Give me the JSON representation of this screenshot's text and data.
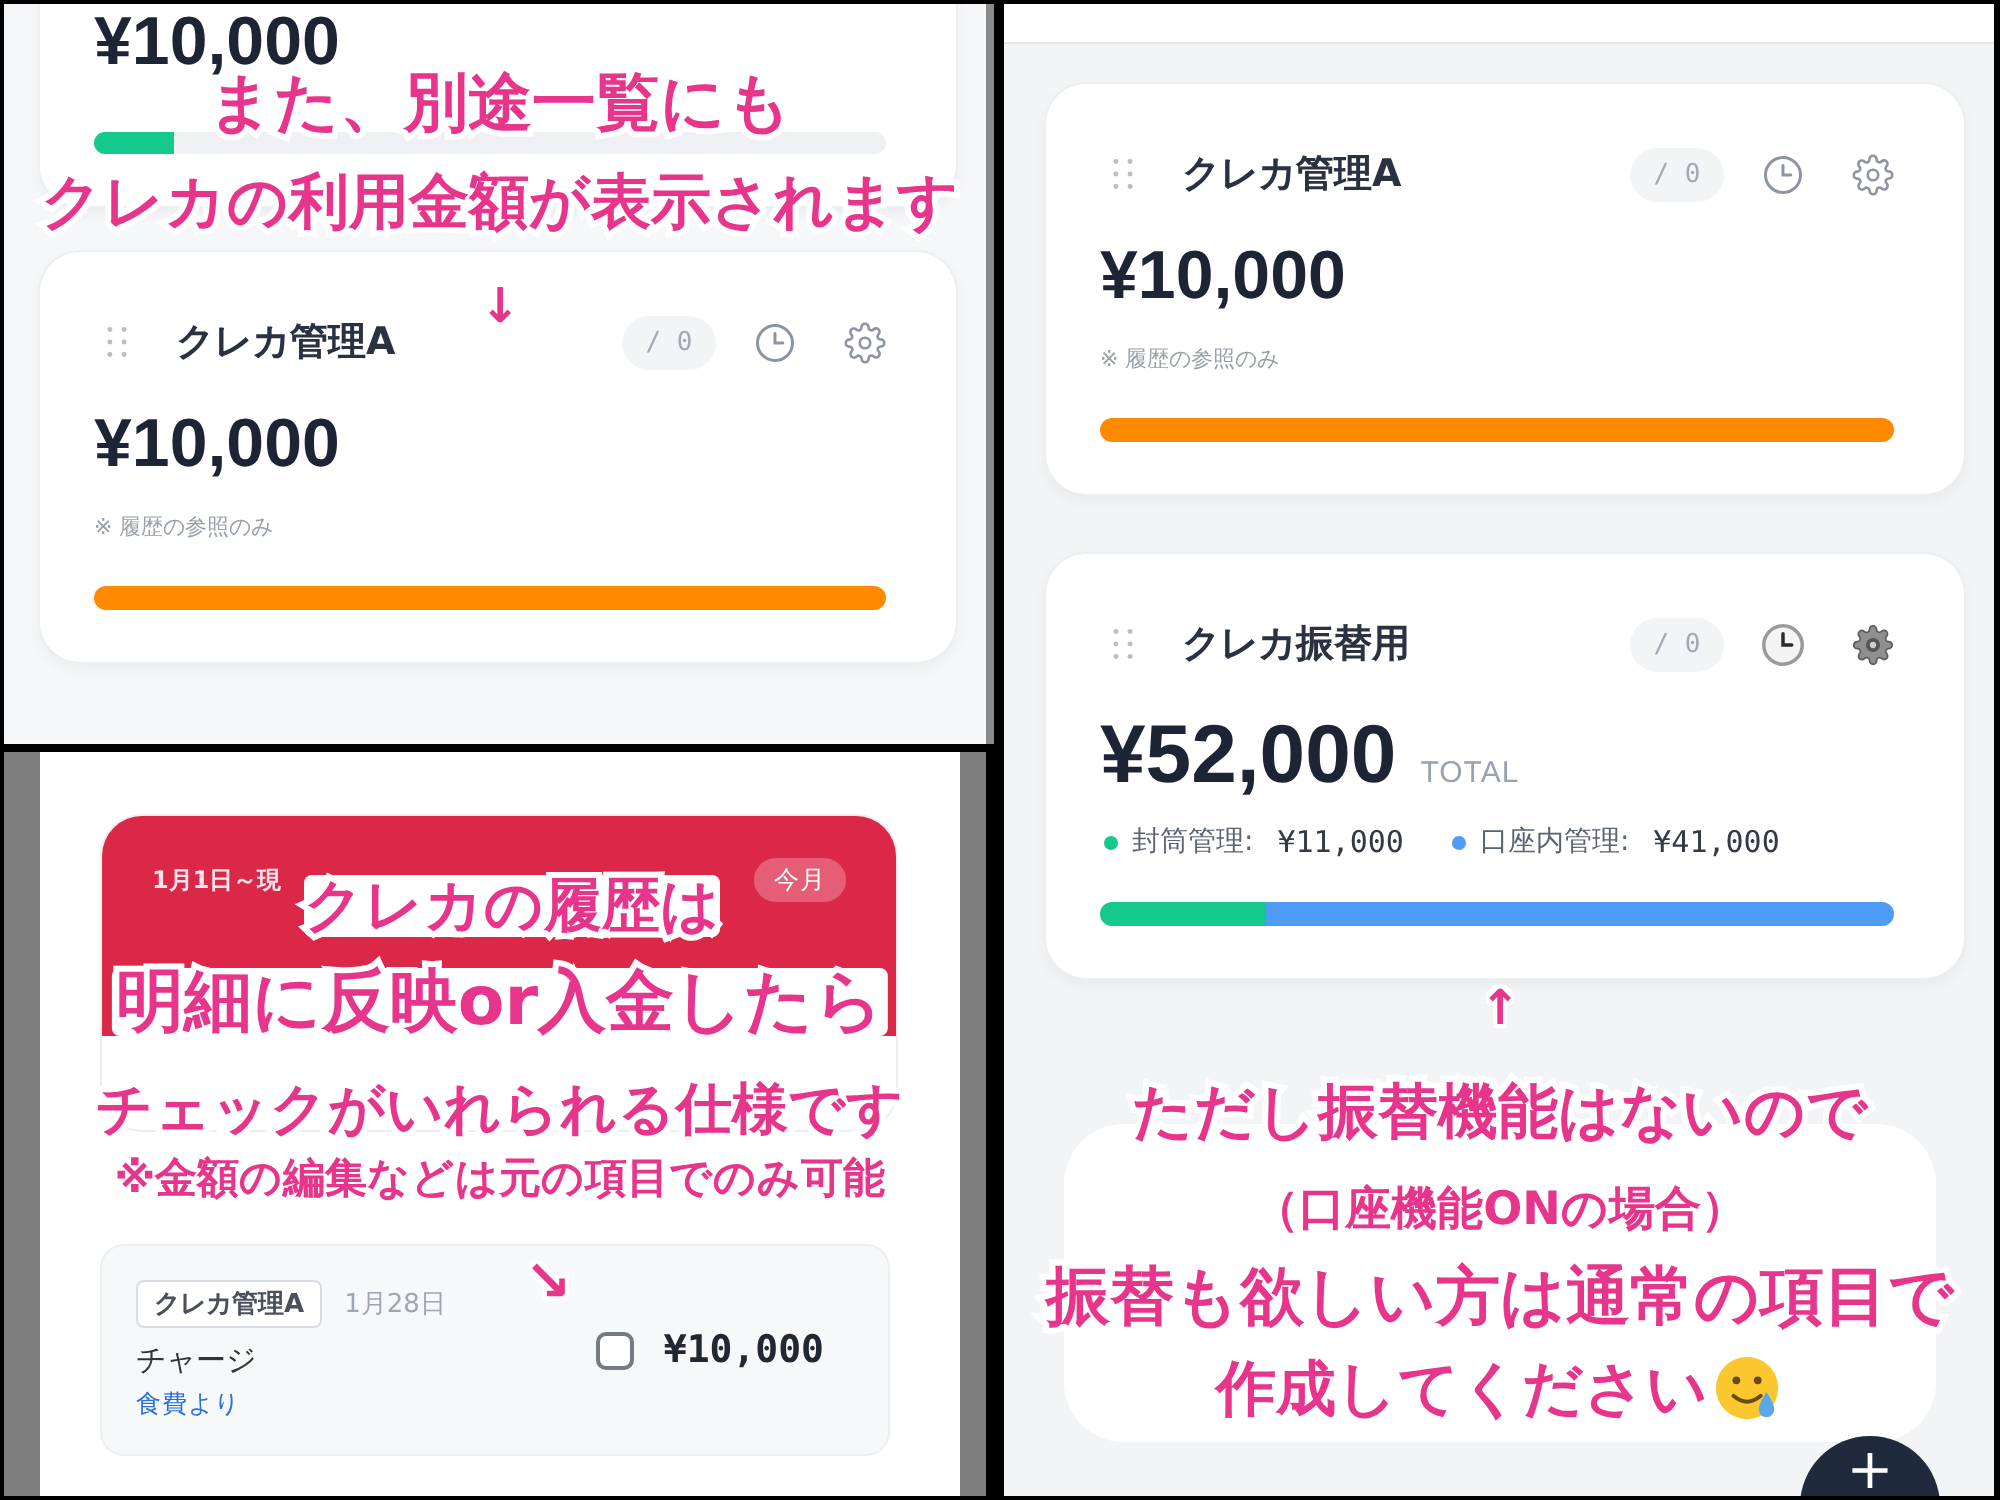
{
  "list_view": {
    "cards": [
      {
        "kind": "cut",
        "amount": "¥10,000",
        "segments": [
          {
            "color": "#14c98b",
            "level": 0.1
          }
        ]
      },
      {
        "kind": "full",
        "title": "クレカ管理A",
        "count": "/ 0",
        "emoji_icons": false,
        "amount": "¥10,000",
        "note": "※ 履歴の参照のみ",
        "segments": [
          {
            "color": "#ff8a00",
            "level": 1
          }
        ]
      }
    ],
    "annotations": [
      {
        "kind": "line",
        "text": "また、別途一覧にも"
      },
      {
        "kind": "line",
        "text": "クレカの利用金額が表示されます"
      },
      {
        "kind": "arrow",
        "text": "↓"
      }
    ]
  },
  "history_view": {
    "summary": {
      "period": "1月1日～現",
      "badge": "今月"
    },
    "transactions": [
      {
        "tag": "クレカ管理A",
        "date": "1月28日",
        "title": "チャージ",
        "source": "食費より",
        "checked": false,
        "amount": "¥10,000"
      }
    ],
    "annotations": [
      {
        "kind": "line",
        "text": "クレカの履歴は"
      },
      {
        "kind": "line",
        "text": "明細に反映or入金したら"
      },
      {
        "kind": "line",
        "text": "チェックがいれられる仕様です"
      },
      {
        "kind": "small",
        "text": "※金額の編集などは元の項目でのみ可能"
      },
      {
        "kind": "arrow",
        "text": "↘"
      }
    ]
  },
  "accounts_view": {
    "cards": [
      {
        "kind": "full",
        "title": "クレカ管理A",
        "count": "/ 0",
        "emoji_icons": false,
        "amount": "¥10,000",
        "note": "※ 履歴の参照のみ",
        "segments": [
          {
            "color": "#ff8a00",
            "level": 1
          }
        ]
      },
      {
        "kind": "split",
        "title": "クレカ振替用",
        "count": "/ 0",
        "emoji_icons": true,
        "amount": "¥52,000",
        "total_label": "TOTAL",
        "legend": [
          {
            "label": "封筒管理:",
            "value": "¥11,000",
            "color": "#14c98b"
          },
          {
            "label": "口座内管理:",
            "value": "¥41,000",
            "color": "#4f9cf6"
          }
        ],
        "segments": [
          {
            "color": "#14c98b",
            "level": 0.21
          },
          {
            "color": "#4f9cf6",
            "level": 0.79
          }
        ]
      }
    ],
    "annotations": [
      {
        "kind": "arrow",
        "text": "↑"
      },
      {
        "kind": "line",
        "text": "ただし振替機能はないので"
      },
      {
        "kind": "small",
        "text": "（口座機能ONの場合）"
      },
      {
        "kind": "line",
        "text": "振替も欲しい方は通常の項目で"
      },
      {
        "kind": "line",
        "text": "作成してください"
      }
    ],
    "add_button": "+"
  }
}
